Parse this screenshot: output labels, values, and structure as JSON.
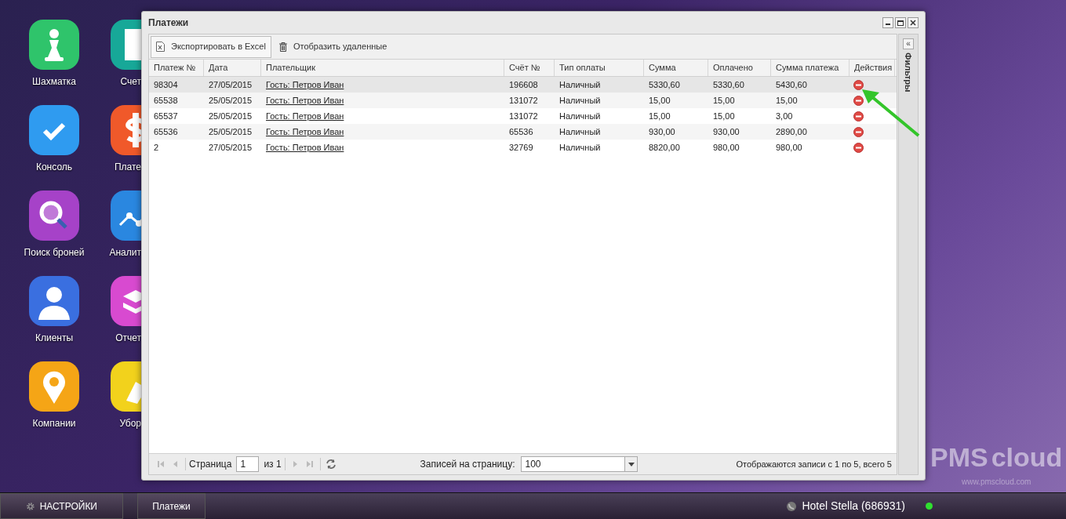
{
  "desktop_icons": [
    {
      "label": "Шахматка",
      "kind": "pawn",
      "color": "#2fc46b"
    },
    {
      "label": "Консоль",
      "kind": "check",
      "color": "#2f9bf0"
    },
    {
      "label": "Поиск броней",
      "kind": "search",
      "color": "#a642c8"
    },
    {
      "label": "Клиенты",
      "kind": "person",
      "color": "#3a6fe0"
    },
    {
      "label": "Компании",
      "kind": "pin",
      "color": "#f5a516"
    },
    {
      "label": "Счет",
      "kind": "doc",
      "color": "#17a898"
    },
    {
      "label": "Плате",
      "kind": "dollar",
      "color": "#f0592a"
    },
    {
      "label": "Аналит",
      "kind": "chart",
      "color": "#2a87e0"
    },
    {
      "label": "Отчет",
      "kind": "stack",
      "color": "#d84ad0"
    },
    {
      "label": "Убор",
      "kind": "broom",
      "color": "#f2d21c"
    }
  ],
  "window": {
    "title": "Платежи"
  },
  "toolbar": [
    {
      "label": "Экспортировать в Excel",
      "kind": "excel"
    },
    {
      "label": "Отобразить удаленные",
      "kind": "trash"
    }
  ],
  "table": {
    "columns": [
      "Платеж №",
      "Дата",
      "Плательщик",
      "Счёт №",
      "Тип оплаты",
      "Сумма",
      "Оплачено",
      "Сумма платежа",
      "Действия"
    ],
    "rows": [
      {
        "selected": true,
        "cells": [
          "98304",
          "27/05/2015",
          "Гость: Петров Иван",
          "196608",
          "Наличный",
          "5330,60",
          "5330,60",
          "5430,60"
        ]
      },
      {
        "selected": false,
        "cells": [
          "65538",
          "25/05/2015",
          "Гость: Петров Иван",
          "131072",
          "Наличный",
          "15,00",
          "15,00",
          "15,00"
        ]
      },
      {
        "selected": false,
        "cells": [
          "65537",
          "25/05/2015",
          "Гость: Петров Иван",
          "131072",
          "Наличный",
          "15,00",
          "15,00",
          "3,00"
        ]
      },
      {
        "selected": false,
        "cells": [
          "65536",
          "25/05/2015",
          "Гость: Петров Иван",
          "65536",
          "Наличный",
          "930,00",
          "930,00",
          "2890,00"
        ]
      },
      {
        "selected": false,
        "cells": [
          "2",
          "27/05/2015",
          "Гость: Петров Иван",
          "32769",
          "Наличный",
          "8820,00",
          "980,00",
          "980,00"
        ]
      }
    ]
  },
  "filters_panel": {
    "title": "Фильтры",
    "collapse": "«"
  },
  "paging": {
    "page_label": "Страница",
    "page": "1",
    "of": "из 1",
    "per_page_label": "Записей на страницу:",
    "per_page": "100",
    "summary": "Отображаются записи с 1 по 5, всего 5"
  },
  "logo": {
    "name_1": "PMS",
    "name_2": "cloud",
    "url": "www.pmscloud.com"
  },
  "taskbar": {
    "settings": "НАСТРОЙКИ",
    "tasks": [
      "Платежи"
    ],
    "hotel": "Hotel Stella (686931)",
    "online": true
  }
}
